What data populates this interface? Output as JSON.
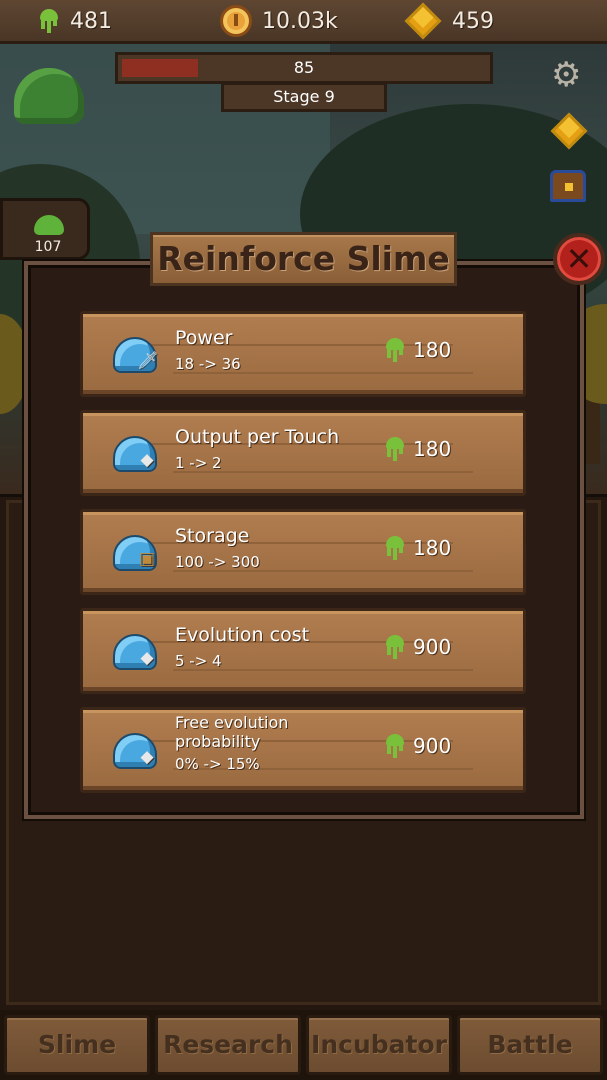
{
  "resources": {
    "slime": "481",
    "coins": "10.03k",
    "gems": "459"
  },
  "stage": {
    "hp": "85",
    "hp_fraction": 0.21,
    "label": "Stage 9"
  },
  "slime_count": "107",
  "dialog": {
    "title": "Reinforce Slime",
    "upgrades": [
      {
        "name": "Power",
        "value": "18 -> 36",
        "cost": "180",
        "icon": "sword-icon"
      },
      {
        "name": "Output per Touch",
        "value": "1 -> 2",
        "cost": "180",
        "icon": "gem-badge-icon"
      },
      {
        "name": "Storage",
        "value": "100 -> 300",
        "cost": "180",
        "icon": "chest-icon"
      },
      {
        "name": "Evolution cost",
        "value": "5 -> 4",
        "cost": "900",
        "icon": "gem-badge-icon"
      },
      {
        "name": "Free evolution probability",
        "value": "0% -> 15%",
        "cost": "900",
        "icon": "gem-badge-icon"
      }
    ]
  },
  "nav": {
    "slime": "Slime",
    "research": "Research",
    "incubator": "Incubator",
    "battle": "Battle"
  }
}
